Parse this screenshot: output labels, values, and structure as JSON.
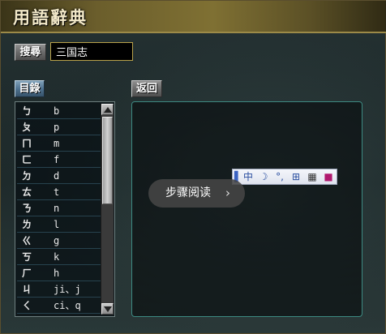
{
  "window": {
    "title": "用語辭典"
  },
  "search": {
    "button_label": "搜尋",
    "value": "三国志"
  },
  "controls": {
    "index_label": "目錄",
    "back_label": "返回"
  },
  "list": {
    "items": [
      {
        "bopo": "ㄅ",
        "latin": "b"
      },
      {
        "bopo": "ㄆ",
        "latin": "p"
      },
      {
        "bopo": "ㄇ",
        "latin": "m"
      },
      {
        "bopo": "ㄈ",
        "latin": "f"
      },
      {
        "bopo": "ㄉ",
        "latin": "d"
      },
      {
        "bopo": "ㄊ",
        "latin": "t"
      },
      {
        "bopo": "ㄋ",
        "latin": "n"
      },
      {
        "bopo": "ㄌ",
        "latin": "l"
      },
      {
        "bopo": "ㄍ",
        "latin": "g"
      },
      {
        "bopo": "ㄎ",
        "latin": "k"
      },
      {
        "bopo": "ㄏ",
        "latin": "h"
      },
      {
        "bopo": "ㄐ",
        "latin": "ji、j"
      },
      {
        "bopo": "ㄑ",
        "latin": "ci、q"
      }
    ]
  },
  "reader": {
    "label": "步骤阅读",
    "chevron": "›"
  },
  "ime": {
    "items": [
      {
        "icon": "ime-mode-icon",
        "glyph": "中"
      },
      {
        "icon": "moon-icon",
        "glyph": "☽"
      },
      {
        "icon": "punctuation-icon",
        "glyph": "°,"
      },
      {
        "icon": "soft-keyboard-icon",
        "glyph": "⊞"
      },
      {
        "icon": "grid-icon",
        "glyph": "▦"
      },
      {
        "icon": "book-icon",
        "glyph": "■"
      }
    ]
  },
  "colors": {
    "title_gold": "#7f7033",
    "pane_border": "#3d8a82",
    "list_divider": "#27424e",
    "input_border": "#b8a14a"
  }
}
